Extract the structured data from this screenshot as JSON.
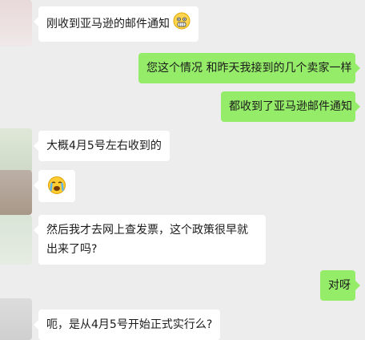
{
  "colors": {
    "background": "#ededed",
    "incoming_bubble": "#ffffff",
    "outgoing_bubble": "#95ec69",
    "text": "#1b1b1b"
  },
  "messages": [
    {
      "side": "left",
      "text": "刚收到亚马逊的邮件通知",
      "emoji": "fearful-face-icon"
    },
    {
      "side": "right",
      "text": "您这个情况 和昨天我接到的几个卖家一样"
    },
    {
      "side": "right",
      "text": "都收到了亚马逊邮件通知"
    },
    {
      "side": "left",
      "text": "大概4月5号左右收到的"
    },
    {
      "side": "left",
      "text": "",
      "emoji": "crying-face-icon"
    },
    {
      "side": "left",
      "text": "然后我才去网上查发票，这个政策很早就出来了吗?"
    },
    {
      "side": "right",
      "text": "对呀"
    },
    {
      "side": "left",
      "text": "呃，是从4月5号开始正式实行么?"
    }
  ]
}
